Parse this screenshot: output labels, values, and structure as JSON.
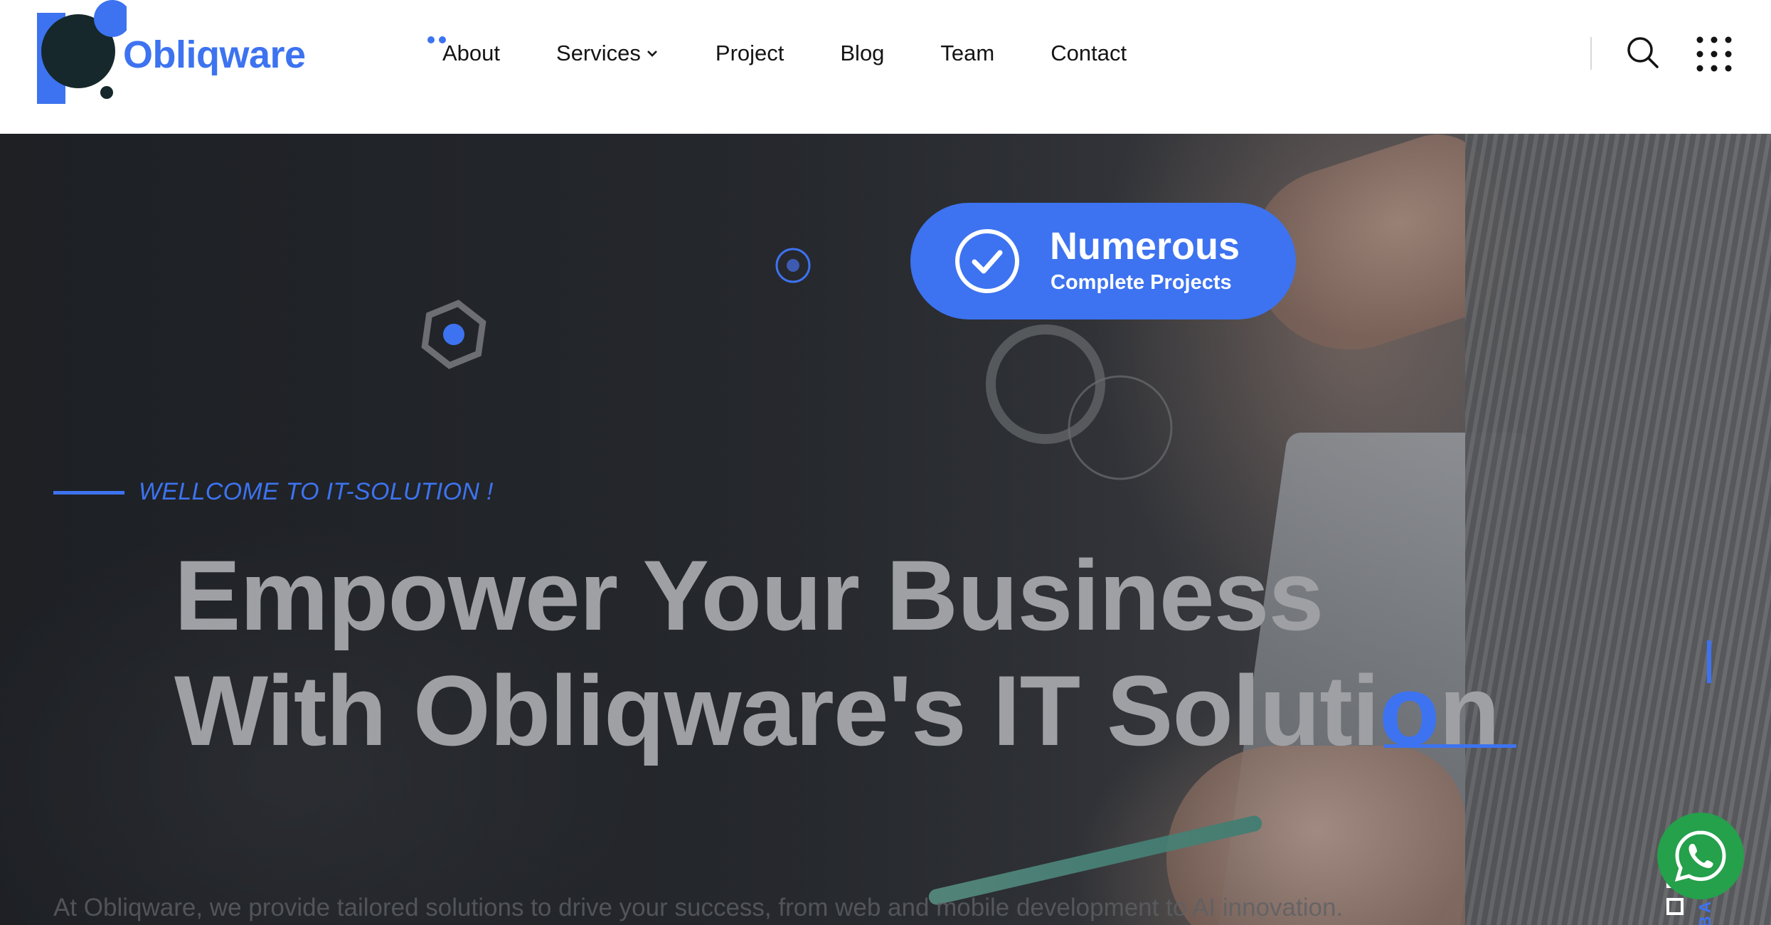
{
  "brand": {
    "name": "Obliqware",
    "colors": {
      "accent": "#3d73f0",
      "dark": "#141414",
      "whatsapp": "#25a04b"
    }
  },
  "nav": {
    "items": [
      {
        "label": "About"
      },
      {
        "label": "Services",
        "has_dropdown": true
      },
      {
        "label": "Project"
      },
      {
        "label": "Blog"
      },
      {
        "label": "Team"
      },
      {
        "label": "Contact"
      }
    ],
    "icons": [
      "search-icon",
      "grid-menu-icon"
    ]
  },
  "hero": {
    "badge": {
      "title": "Numerous",
      "subtitle": "Complete Projects",
      "icon": "check-circle-icon"
    },
    "eyebrow": "WELLCOME TO IT-SOLUTION !",
    "headline": {
      "line1": "Empower Your Business",
      "line2_prefix": "With Obliqware's IT Soluti",
      "line2_highlight": "o",
      "line2_suffix": "n"
    },
    "intro": "At Obliqware, we provide tailored solutions to drive your success, from web and mobile development to AI innovation."
  },
  "back_to_top": {
    "label": "BACK TOP"
  },
  "whatsapp": {
    "icon": "whatsapp-icon"
  }
}
